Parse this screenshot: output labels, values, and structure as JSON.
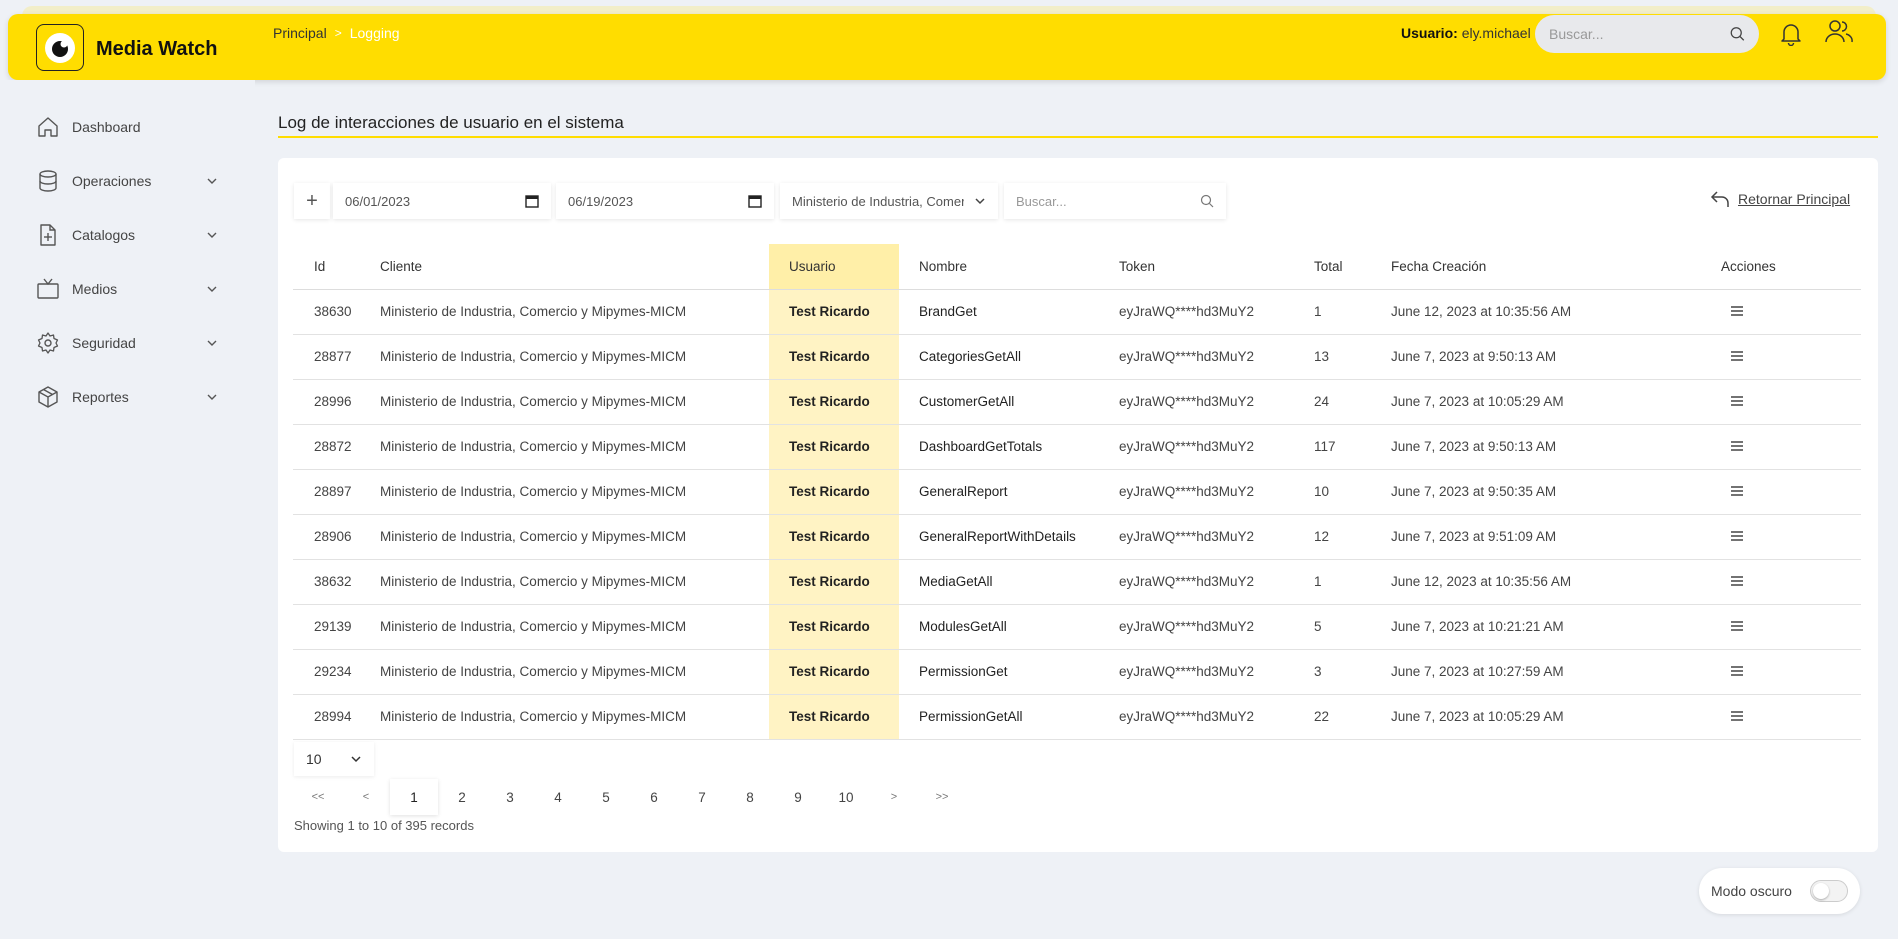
{
  "app": {
    "title": "Media Watch"
  },
  "breadcrumb": {
    "home": "Principal",
    "separator": ">",
    "current": "Logging"
  },
  "header": {
    "user_prefix": "Usuario:",
    "user_name": "ely.michael",
    "search_placeholder": "Buscar..."
  },
  "sidebar": {
    "items": [
      {
        "label": "Dashboard",
        "icon": "home-icon",
        "expandable": false
      },
      {
        "label": "Operaciones",
        "icon": "database-icon",
        "expandable": true
      },
      {
        "label": "Catalogos",
        "icon": "file-plus-icon",
        "expandable": true
      },
      {
        "label": "Medios",
        "icon": "tv-icon",
        "expandable": true
      },
      {
        "label": "Seguridad",
        "icon": "gear-icon",
        "expandable": true
      },
      {
        "label": "Reportes",
        "icon": "box-icon",
        "expandable": true
      }
    ]
  },
  "page": {
    "title": "Log de interacciones de usuario en el sistema"
  },
  "filters": {
    "add_label": "+",
    "date_from": "06/01/2023",
    "date_to": "06/19/2023",
    "client_selected": "Ministerio de Industria, Comercio y Mipymes-MICM",
    "search_placeholder": "Buscar...",
    "return_label": "Retornar Principal"
  },
  "table": {
    "headers": {
      "id": "Id",
      "cliente": "Cliente",
      "usuario": "Usuario",
      "nombre": "Nombre",
      "token": "Token",
      "total": "Total",
      "fecha": "Fecha Creación",
      "acciones": "Acciones"
    },
    "rows": [
      {
        "id": "38630",
        "cliente": "Ministerio de Industria, Comercio y Mipymes-MICM",
        "usuario": "Test Ricardo",
        "nombre": "BrandGet",
        "token": "eyJraWQ****hd3MuY2",
        "total": "1",
        "fecha": "June 12, 2023 at 10:35:56 AM"
      },
      {
        "id": "28877",
        "cliente": "Ministerio de Industria, Comercio y Mipymes-MICM",
        "usuario": "Test Ricardo",
        "nombre": "CategoriesGetAll",
        "token": "eyJraWQ****hd3MuY2",
        "total": "13",
        "fecha": "June 7, 2023 at 9:50:13 AM"
      },
      {
        "id": "28996",
        "cliente": "Ministerio de Industria, Comercio y Mipymes-MICM",
        "usuario": "Test Ricardo",
        "nombre": "CustomerGetAll",
        "token": "eyJraWQ****hd3MuY2",
        "total": "24",
        "fecha": "June 7, 2023 at 10:05:29 AM"
      },
      {
        "id": "28872",
        "cliente": "Ministerio de Industria, Comercio y Mipymes-MICM",
        "usuario": "Test Ricardo",
        "nombre": "DashboardGetTotals",
        "token": "eyJraWQ****hd3MuY2",
        "total": "117",
        "fecha": "June 7, 2023 at 9:50:13 AM"
      },
      {
        "id": "28897",
        "cliente": "Ministerio de Industria, Comercio y Mipymes-MICM",
        "usuario": "Test Ricardo",
        "nombre": "GeneralReport",
        "token": "eyJraWQ****hd3MuY2",
        "total": "10",
        "fecha": "June 7, 2023 at 9:50:35 AM"
      },
      {
        "id": "28906",
        "cliente": "Ministerio de Industria, Comercio y Mipymes-MICM",
        "usuario": "Test Ricardo",
        "nombre": "GeneralReportWithDetails",
        "token": "eyJraWQ****hd3MuY2",
        "total": "12",
        "fecha": "June 7, 2023 at 9:51:09 AM"
      },
      {
        "id": "38632",
        "cliente": "Ministerio de Industria, Comercio y Mipymes-MICM",
        "usuario": "Test Ricardo",
        "nombre": "MediaGetAll",
        "token": "eyJraWQ****hd3MuY2",
        "total": "1",
        "fecha": "June 12, 2023 at 10:35:56 AM"
      },
      {
        "id": "29139",
        "cliente": "Ministerio de Industria, Comercio y Mipymes-MICM",
        "usuario": "Test Ricardo",
        "nombre": "ModulesGetAll",
        "token": "eyJraWQ****hd3MuY2",
        "total": "5",
        "fecha": "June 7, 2023 at 10:21:21 AM"
      },
      {
        "id": "29234",
        "cliente": "Ministerio de Industria, Comercio y Mipymes-MICM",
        "usuario": "Test Ricardo",
        "nombre": "PermissionGet",
        "token": "eyJraWQ****hd3MuY2",
        "total": "3",
        "fecha": "June 7, 2023 at 10:27:59 AM"
      },
      {
        "id": "28994",
        "cliente": "Ministerio de Industria, Comercio y Mipymes-MICM",
        "usuario": "Test Ricardo",
        "nombre": "PermissionGetAll",
        "token": "eyJraWQ****hd3MuY2",
        "total": "22",
        "fecha": "June 7, 2023 at 10:05:29 AM"
      }
    ]
  },
  "pagination": {
    "page_size": "10",
    "first": "<<",
    "prev": "<",
    "pages": [
      "1",
      "2",
      "3",
      "4",
      "5",
      "6",
      "7",
      "8",
      "9",
      "10"
    ],
    "current_page": "1",
    "next": ">",
    "last": ">>",
    "summary": "Showing 1 to 10 of 395 records"
  },
  "dark_mode": {
    "label": "Modo oscuro",
    "enabled": false
  },
  "colors": {
    "accent": "#ffdd00",
    "highlight_column": "#fff3c4"
  }
}
